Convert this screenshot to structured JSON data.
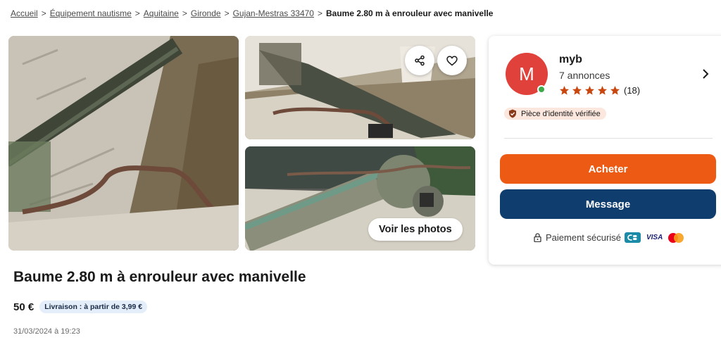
{
  "breadcrumb": {
    "items": [
      "Accueil",
      "Équipement nautisme",
      "Aquitaine",
      "Gironde",
      "Gujan-Mestras 33470"
    ],
    "separator": ">",
    "current": "Baume 2.80 m à enrouleur avec manivelle"
  },
  "gallery": {
    "see_photos_label": "Voir les photos",
    "share_icon": "share-icon",
    "favorite_icon": "heart-icon"
  },
  "listing": {
    "title": "Baume 2.80 m à enrouleur avec manivelle",
    "price": "50 €",
    "delivery": "Livraison : à partir de 3,99 €",
    "date": "31/03/2024 à 19:23"
  },
  "seller": {
    "initial": "M",
    "name": "myb",
    "ads_count": "7 annonces",
    "rating_stars": 5,
    "rating_count": "(18)",
    "verified_label": "Pièce d'identité vérifiée",
    "online": true
  },
  "actions": {
    "buy_label": "Acheter",
    "message_label": "Message"
  },
  "payment": {
    "label": "Paiement sécurisé",
    "cb": "CB",
    "visa": "VISA"
  },
  "colors": {
    "accent_orange": "#ec5a13",
    "navy": "#0e3d6e",
    "avatar_red": "#e0413a",
    "star": "#c9460f",
    "online": "#3caa4a",
    "delivery_bg": "#e3eefa",
    "verified_bg": "#fbe7dd"
  }
}
